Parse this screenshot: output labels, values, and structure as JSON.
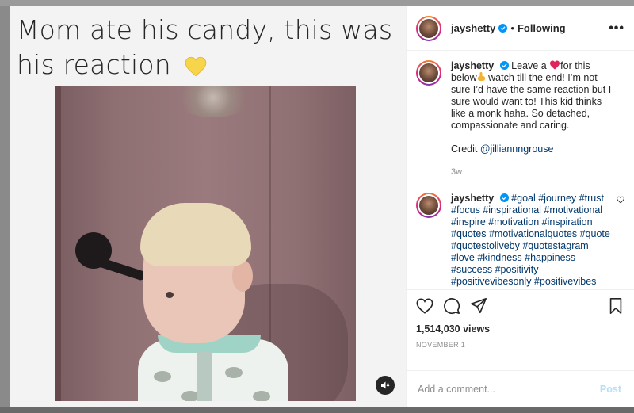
{
  "media": {
    "caption_line1": "Mom ate his candy, this was",
    "caption_line2": "his reaction",
    "caption_emoji": "yellow-heart-icon"
  },
  "post_header": {
    "username": "jayshetty",
    "separator": "•",
    "follow_status": "Following",
    "more_label": "•••"
  },
  "comments": [
    {
      "username": "jayshetty",
      "text_before_heart": "Leave a ",
      "text_after_heart": "for this below",
      "text_rest": "watch till the end! I’m not sure I’d have the same reaction but I sure would want to! This kid thinks like a monk haha. So detached, compassionate and caring.",
      "credit_label": "Credit ",
      "credit_handle": "@jilliannngrouse",
      "time": "3w"
    },
    {
      "username": "jayshetty",
      "hashtags": "#goal #journey #trust #focus #inspirational #motivational #inspire #motivation #inspiration #quotes #motivationalquotes #quote #quotestoliveby #quotestagram #love #kindness #happiness #success #positivity #positivevibesonly #positivevibes #dailyquote #dailyquotes"
    }
  ],
  "stats": {
    "views": "1,514,030 views",
    "date": "NOVEMBER 1"
  },
  "composer": {
    "placeholder": "Add a comment...",
    "post_label": "Post"
  },
  "colors": {
    "link": "#00376b",
    "verified": "#0095f6",
    "post_disabled": "#b2dffc"
  }
}
